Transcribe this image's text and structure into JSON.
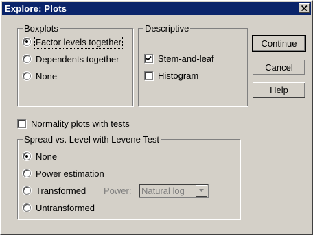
{
  "window": {
    "title": "Explore: Plots"
  },
  "boxplots": {
    "legend": "Boxplots",
    "options": [
      {
        "label": "Factor levels together",
        "selected": true
      },
      {
        "label": "Dependents together",
        "selected": false
      },
      {
        "label": "None",
        "selected": false
      }
    ]
  },
  "descriptive": {
    "legend": "Descriptive",
    "stem_and_leaf": {
      "label": "Stem-and-leaf",
      "checked": true
    },
    "histogram": {
      "label": "Histogram",
      "checked": false
    }
  },
  "normality": {
    "label": "Normality plots with tests",
    "checked": false
  },
  "spread": {
    "legend": "Spread vs. Level with Levene Test",
    "options": [
      {
        "label": "None",
        "selected": true
      },
      {
        "label": "Power estimation",
        "selected": false
      },
      {
        "label": "Transformed",
        "selected": false
      },
      {
        "label": "Untransformed",
        "selected": false
      }
    ],
    "power_label": "Power:",
    "power_value": "Natural log"
  },
  "buttons": {
    "continue": "Continue",
    "cancel": "Cancel",
    "help": "Help"
  },
  "colors": {
    "titlebar": "#0a246a",
    "face": "#d4d0c8",
    "disabled_text": "#808080"
  }
}
